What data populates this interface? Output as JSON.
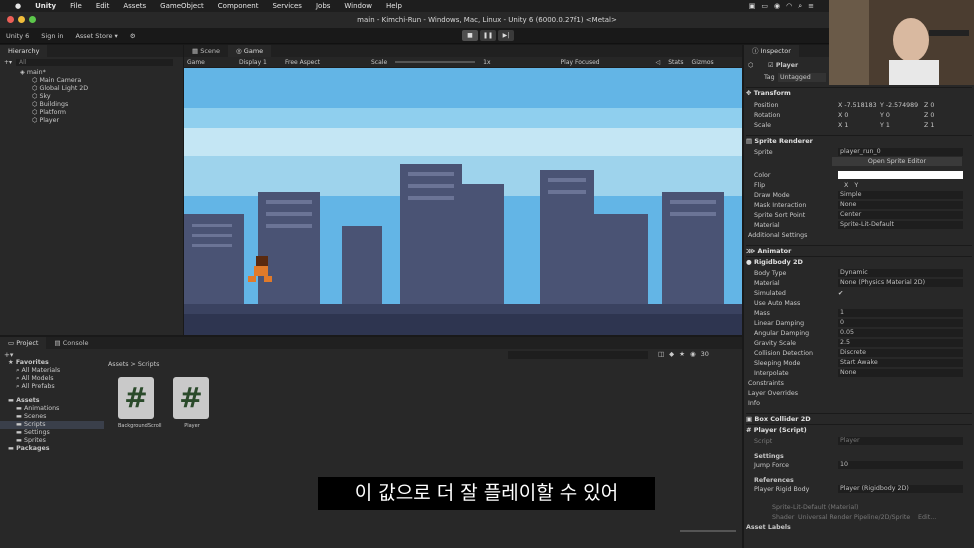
{
  "menu": {
    "items": [
      "Unity",
      "File",
      "Edit",
      "Assets",
      "GameObject",
      "Component",
      "Services",
      "Jobs",
      "Window",
      "Help"
    ]
  },
  "window": {
    "title": "main - Kimchi-Run - Windows, Mac, Linux - Unity 6 (6000.0.27f1) <Metal>"
  },
  "toolbar": {
    "account": "Unity 6",
    "signin": "Sign in",
    "asset_store": "Asset Store ▾"
  },
  "hierarchy": {
    "tab": "Hierarchy",
    "search": "All",
    "scene": "main*",
    "items": [
      "Main Camera",
      "Global Light 2D",
      "Sky",
      "Buildings",
      "Platform",
      "Player"
    ]
  },
  "scene_tabs": {
    "scene": "Scene",
    "game": "Game"
  },
  "gamebar": {
    "mode": "Game",
    "display": "Display 1",
    "aspect": "Free Aspect",
    "scale_label": "Scale",
    "scale_value": "1x",
    "play_focused": "Play Focused",
    "stats": "Stats",
    "gizmos": "Gizmos"
  },
  "inspector": {
    "tab": "Inspector",
    "object": "Player",
    "tag_label": "Tag",
    "tag_value": "Untagged",
    "transform": {
      "title": "Transform",
      "position_label": "Position",
      "pos_x": "-7.518183",
      "pos_y": "-2.574989",
      "pos_z": "0",
      "rotation_label": "Rotation",
      "rot_x": "0",
      "rot_y": "0",
      "rot_z": "0",
      "scale_label": "Scale",
      "scale_x": "1",
      "scale_y": "1",
      "scale_z": "1",
      "x": "X",
      "y": "Y",
      "z": "Z"
    },
    "sprite_renderer": {
      "title": "Sprite Renderer",
      "sprite_label": "Sprite",
      "sprite": "player_run_0",
      "open_editor": "Open Sprite Editor",
      "color_label": "Color",
      "flip_label": "Flip",
      "flip_x": "X",
      "flip_y": "Y",
      "draw_mode_label": "Draw Mode",
      "draw_mode": "Simple",
      "mask_label": "Mask Interaction",
      "mask": "None",
      "sort_label": "Sprite Sort Point",
      "sort": "Center",
      "material_label": "Material",
      "material": "Sprite-Lit-Default",
      "additional": "Additional Settings"
    },
    "animator": {
      "title": "Animator"
    },
    "rigidbody": {
      "title": "Rigidbody 2D",
      "body_type_label": "Body Type",
      "body_type": "Dynamic",
      "material_label": "Material",
      "material": "None (Physics Material 2D)",
      "simulated_label": "Simulated",
      "auto_mass_label": "Use Auto Mass",
      "mass_label": "Mass",
      "mass": "1",
      "lin_damp_label": "Linear Damping",
      "lin_damp": "0",
      "ang_damp_label": "Angular Damping",
      "ang_damp": "0.05",
      "gravity_label": "Gravity Scale",
      "gravity": "2.5",
      "collision_label": "Collision Detection",
      "collision": "Discrete",
      "sleep_label": "Sleeping Mode",
      "sleep": "Start Awake",
      "interp_label": "Interpolate",
      "interp": "None",
      "constraints": "Constraints",
      "layer_overrides": "Layer Overrides",
      "info": "Info"
    },
    "box_collider": {
      "title": "Box Collider 2D"
    },
    "player_script": {
      "title": "Player (Script)",
      "script_label": "Script",
      "script": "Player",
      "settings": "Settings",
      "jump_label": "Jump Force",
      "jump": "10",
      "references": "References",
      "rb_label": "Player Rigid Body",
      "rb": "Player (Rigidbody 2D)"
    },
    "sprite_lit": "Sprite-Lit-Default (Material)",
    "shader_label": "Shader",
    "shader": "Universal Render Pipeline/2D/Sprite-L",
    "edit_btn": "Edit...",
    "asset_labels": "Asset Labels"
  },
  "project": {
    "tabs": [
      "Project",
      "Console"
    ],
    "favorites": "Favorites",
    "fav_items": [
      "All Materials",
      "All Models",
      "All Prefabs"
    ],
    "assets": "Assets",
    "asset_folders": [
      "Animations",
      "Scenes",
      "Scripts",
      "Settings",
      "Sprites"
    ],
    "packages": "Packages",
    "breadcrumb_root": "Assets",
    "breadcrumb_sep": ">",
    "breadcrumb_leaf": "Scripts",
    "count": "30",
    "files": [
      {
        "name": "BackgroundScroll",
        "glyph": "#"
      },
      {
        "name": "Player",
        "glyph": "#"
      }
    ]
  },
  "subtitle": "이 값으로 더 잘 플레이할 수 있어",
  "colors": {
    "accent": "#3a72b0",
    "sky_top": "#5aaee0",
    "building": "#4a5374",
    "ground": "#2e3550"
  }
}
